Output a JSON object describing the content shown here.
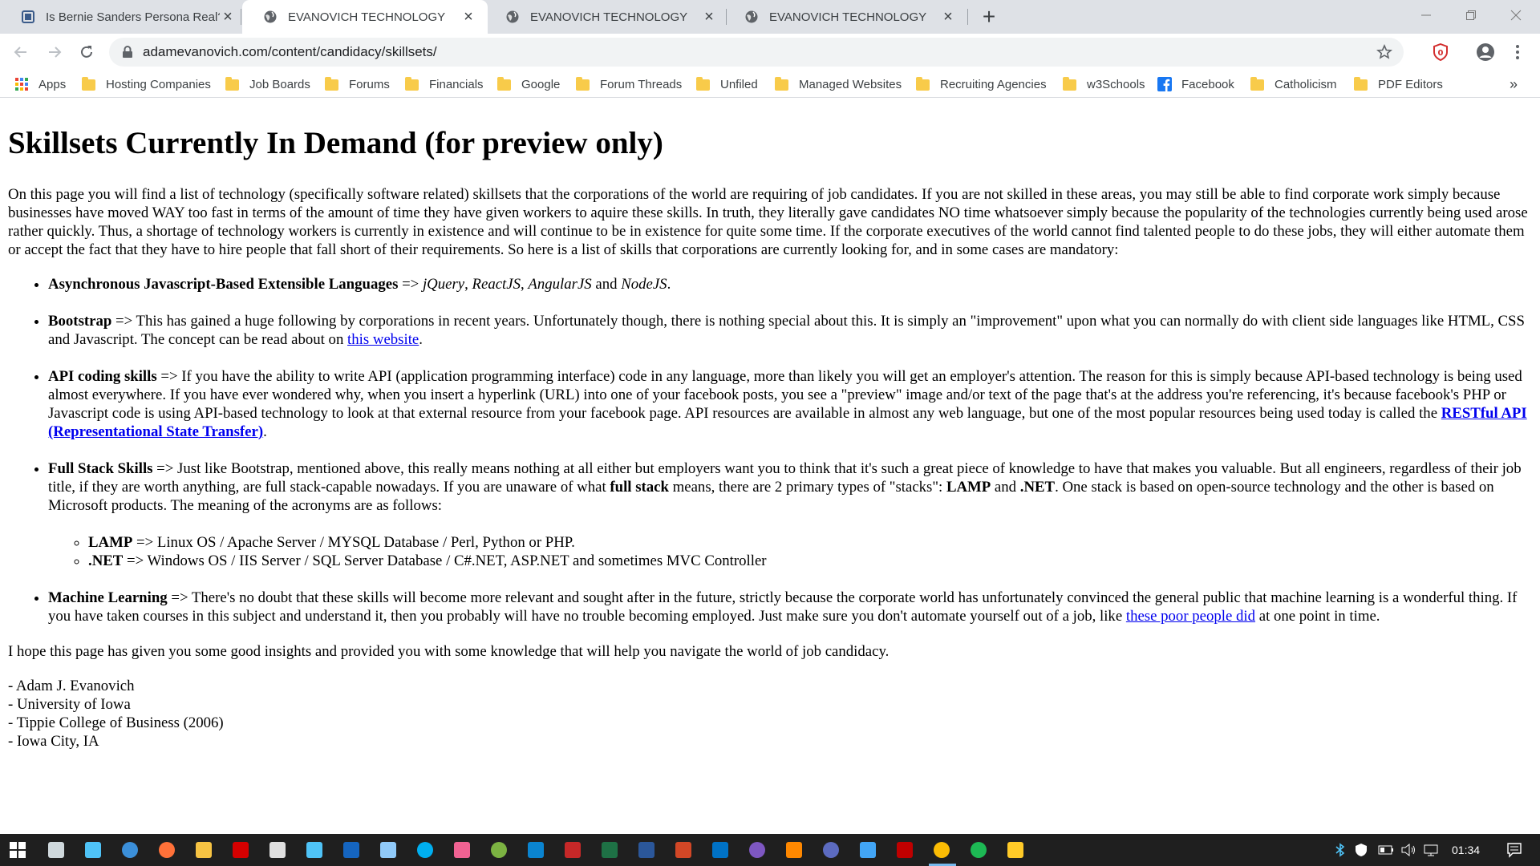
{
  "browser": {
    "tabs": [
      {
        "title": "Is Bernie Sanders Persona Real? |",
        "favicon": "page-icon",
        "active": false
      },
      {
        "title": "EVANOVICH TECHNOLOGY",
        "favicon": "globe-icon",
        "active": true
      },
      {
        "title": "EVANOVICH TECHNOLOGY",
        "favicon": "globe-icon",
        "active": false
      },
      {
        "title": "EVANOVICH TECHNOLOGY",
        "favicon": "globe-icon",
        "active": false
      }
    ],
    "new_tab": "+",
    "window_controls": {
      "minimize": "—",
      "maximize": "❐",
      "close": "✕"
    },
    "url": "adamevanovich.com/content/candidacy/skillsets/",
    "bookmarks": [
      {
        "label": "Apps",
        "icon": "apps-grid-icon"
      },
      {
        "label": "Hosting Companies",
        "icon": "folder-icon"
      },
      {
        "label": "Job Boards",
        "icon": "folder-icon"
      },
      {
        "label": "Forums",
        "icon": "folder-icon"
      },
      {
        "label": "Financials",
        "icon": "folder-icon"
      },
      {
        "label": "Google",
        "icon": "folder-icon"
      },
      {
        "label": "Forum Threads",
        "icon": "folder-icon"
      },
      {
        "label": "Unfiled",
        "icon": "folder-icon"
      },
      {
        "label": "Managed Websites",
        "icon": "folder-icon"
      },
      {
        "label": "Recruiting Agencies",
        "icon": "folder-icon"
      },
      {
        "label": "w3Schools",
        "icon": "folder-icon"
      },
      {
        "label": "Facebook",
        "icon": "facebook-icon"
      },
      {
        "label": "Catholicism",
        "icon": "folder-icon"
      },
      {
        "label": "PDF Editors",
        "icon": "folder-icon"
      }
    ],
    "bookmarks_overflow": "»"
  },
  "page": {
    "heading": "Skillsets Currently In Demand (for preview only)",
    "intro": "On this page you will find a list of technology (specifically software related) skillsets that the corporations of the world are requiring of job candidates. If you are not skilled in these areas, you may still be able to find corporate work simply because businesses have moved WAY too fast in terms of the amount of time they have given workers to aquire these skills. In truth, they literally gave candidates NO time whatsoever simply because the popularity of the technologies currently being used arose rather quickly. Thus, a shortage of technology workers is currently in existence and will continue to be in existence for quite some time. If the corporate executives of the world cannot find talented people to do these jobs, they will either automate them or accept the fact that they have to hire people that fall short of their requirements. So here is a list of skills that corporations are currently looking for, and in some cases are mandatory:",
    "skills": {
      "async": {
        "name": "Asynchronous Javascript-Based Extensible Languages",
        "arrow": " => ",
        "lib1": "jQuery",
        "sep1": ", ",
        "lib2": "ReactJS",
        "sep2": ", ",
        "lib3": "AngularJS",
        "and": " and ",
        "lib4": "NodeJS",
        "end": "."
      },
      "bootstrap": {
        "name": "Bootstrap",
        "text": " => This has gained a huge following by corporations in recent years. Unfortunately though, there is nothing special about this. It is simply an \"improvement\" upon what you can normally do with client side languages like HTML, CSS and Javascript. The concept can be read about on ",
        "link": "this website",
        "end": "."
      },
      "api": {
        "name": "API coding skills",
        "text": " => If you have the ability to write API (application programming interface) code in any language, more than likely you will get an employer's attention. The reason for this is simply because API-based technology is being used almost everywhere. If you have ever wondered why, when you insert a hyperlink (URL) into one of your facebook posts, you see a \"preview\" image and/or text of the page that's at the address you're referencing, it's because facebook's PHP or Javascript code is using API-based technology to look at that external resource from your facebook page. API resources are available in almost any web language, but one of the most popular resources being used today is called the ",
        "link": "RESTful API (Representational State Transfer)",
        "end": "."
      },
      "fullstack": {
        "name": "Full Stack Skills",
        "text1": " => Just like Bootstrap, mentioned above, this really means nothing at all either but employers want you to think that it's such a great piece of knowledge to have that makes you valuable. But all engineers, regardless of their job title, if they are worth anything, are full stack-capable nowadays. If you are unaware of what ",
        "bold1": "full stack",
        "text2": " means, there are 2 primary types of \"stacks\": ",
        "bold2": "LAMP",
        "text3": " and ",
        "bold3": ".NET",
        "text4": ". One stack is based on open-source technology and the other is based on Microsoft products. The meaning of the acronyms are as follows:",
        "stacks": [
          {
            "name": "LAMP",
            "text": " => Linux OS / Apache Server / MYSQL Database / Perl, Python or PHP."
          },
          {
            "name": ".NET",
            "text": " => Windows OS / IIS Server / SQL Server Database / C#.NET, ASP.NET and sometimes MVC Controller"
          }
        ]
      },
      "ml": {
        "name": "Machine Learning",
        "text": " => There's no doubt that these skills will become more relevant and sought after in the future, strictly because the corporate world has unfortunately convinced the general public that machine learning is a wonderful thing. If you have taken courses in this subject and understand it, then you probably will have no trouble becoming employed. Just make sure you don't automate yourself out of a job, like ",
        "link": "these poor people did",
        "end": " at one point in time."
      }
    },
    "outro": "I hope this page has given you some good insights and provided you with some knowledge that will help you navigate the world of job candidacy.",
    "signature": [
      "- Adam J. Evanovich",
      "- University of Iowa",
      "- Tippie College of Business (2006)",
      "- Iowa City, IA"
    ]
  },
  "taskbar": {
    "clock": "01:34",
    "icons": [
      {
        "name": "start-icon",
        "color": "#ffffff"
      },
      {
        "name": "task-view-icon",
        "color": "#cfd8dc"
      },
      {
        "name": "file-explorer-small-icon",
        "color": "#4fc3f7"
      },
      {
        "name": "edge-icon",
        "color": "#3b8fd9"
      },
      {
        "name": "firefox-icon",
        "color": "#ff7139"
      },
      {
        "name": "git-icon",
        "color": "#f6c343"
      },
      {
        "name": "acrobat-icon",
        "color": "#d50000"
      },
      {
        "name": "camera-icon",
        "color": "#e0e0e0"
      },
      {
        "name": "settings-app-icon",
        "color": "#4fc3f7"
      },
      {
        "name": "teamviewer-icon",
        "color": "#1565c0"
      },
      {
        "name": "network-icon",
        "color": "#90caf9"
      },
      {
        "name": "skype-icon",
        "color": "#00aff0"
      },
      {
        "name": "paint-icon",
        "color": "#f06292"
      },
      {
        "name": "greenshot-icon",
        "color": "#7cb342"
      },
      {
        "name": "vscode-icon",
        "color": "#0a84d0"
      },
      {
        "name": "access-icon",
        "color": "#c62828"
      },
      {
        "name": "excel-icon",
        "color": "#1e7145"
      },
      {
        "name": "word-icon",
        "color": "#2b579a"
      },
      {
        "name": "powerpoint-icon",
        "color": "#d24726"
      },
      {
        "name": "outlook-icon",
        "color": "#0072c6"
      },
      {
        "name": "tor-icon",
        "color": "#7e57c2"
      },
      {
        "name": "vlc-icon",
        "color": "#ff8800"
      },
      {
        "name": "media-icon",
        "color": "#5c6bc0"
      },
      {
        "name": "remote-desktop-icon",
        "color": "#42a5f5"
      },
      {
        "name": "filezilla-icon",
        "color": "#bf0000"
      },
      {
        "name": "chrome-icon",
        "color": "#fbbc04"
      },
      {
        "name": "spotify-icon",
        "color": "#1db954"
      },
      {
        "name": "file-explorer-icon",
        "color": "#ffca28"
      }
    ],
    "tray_icons": [
      "bluetooth-icon",
      "security-icon",
      "battery-icon",
      "volume-icon",
      "display-icon",
      "notification-icon"
    ]
  }
}
